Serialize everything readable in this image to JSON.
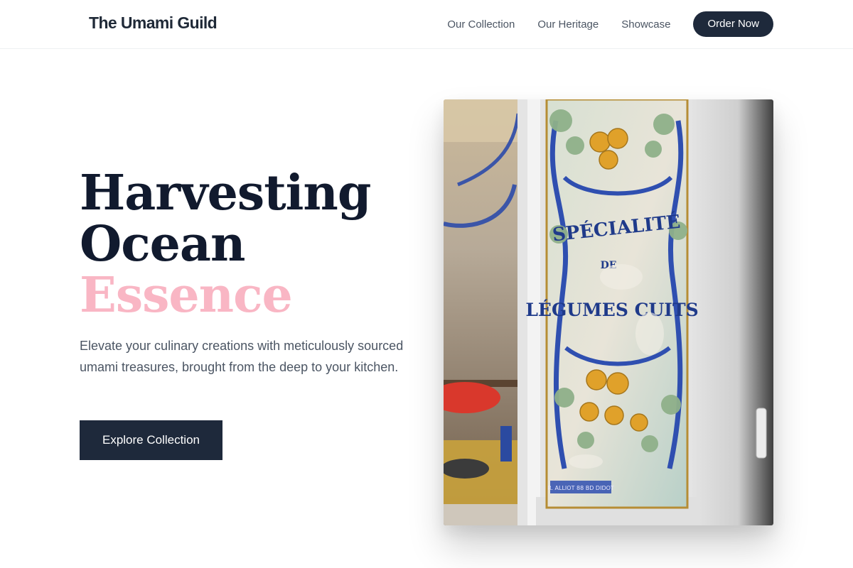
{
  "header": {
    "brand": "The Umami Guild",
    "nav": [
      {
        "label": "Our Collection"
      },
      {
        "label": "Our Heritage"
      },
      {
        "label": "Showcase"
      }
    ],
    "cta_label": "Order Now"
  },
  "hero": {
    "title_line1": "Harvesting",
    "title_line2": "Ocean",
    "title_accent": "Essence",
    "subtitle": "Elevate your culinary creations with meticulously sourced umami treasures, brought from the deep to your kitchen.",
    "cta_label": "Explore Collection"
  },
  "image": {
    "sign_line1": "SPÉCIALITÉ",
    "sign_line2": "DE",
    "sign_line3": "LÉGUMES CUITS",
    "maker_mark": "R. ALLIOT 88 BD DIDOT"
  },
  "colors": {
    "primary_dark": "#1e293b",
    "title_ink": "#111a2e",
    "accent_pink": "#f9b6c4",
    "body_text": "#4b5563"
  }
}
